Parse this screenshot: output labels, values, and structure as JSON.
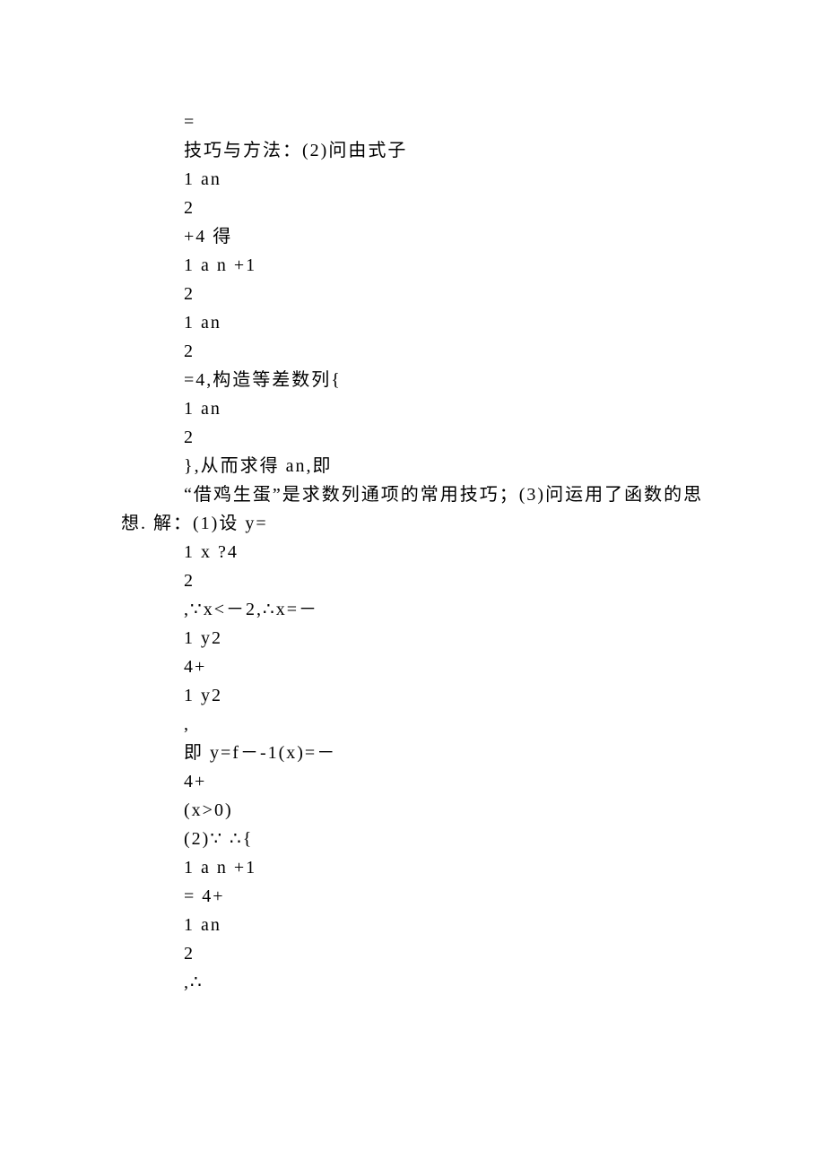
{
  "lines": [
    {
      "cls": "line",
      "text": "="
    },
    {
      "cls": "line",
      "text": "技巧与方法：(2)问由式子"
    },
    {
      "cls": "line",
      "text": "1 an"
    },
    {
      "cls": "line",
      "text": "2"
    },
    {
      "cls": "line",
      "text": "+4 得"
    },
    {
      "cls": "line",
      "text": "1 a n +1"
    },
    {
      "cls": "line",
      "text": "2"
    },
    {
      "cls": "line",
      "text": "1 an"
    },
    {
      "cls": "line",
      "text": "2"
    },
    {
      "cls": "line",
      "text": "=4,构造等差数列{"
    },
    {
      "cls": "line",
      "text": "1 an"
    },
    {
      "cls": "line",
      "text": "2"
    },
    {
      "cls": "line",
      "text": "},从而求得 an,即"
    },
    {
      "cls": "line",
      "text": "“借鸡生蛋”是求数列通项的常用技巧；(3)问运用了函数的思"
    },
    {
      "cls": "line-out",
      "text": "想. 解：(1)设 y="
    },
    {
      "cls": "line",
      "text": "1 x ?4"
    },
    {
      "cls": "line",
      "text": "2"
    },
    {
      "cls": "line",
      "text": ",∵x<－2,∴x=－"
    },
    {
      "cls": "line",
      "text": "1 y2"
    },
    {
      "cls": "line",
      "text": "4+"
    },
    {
      "cls": "line",
      "text": "1 y2"
    },
    {
      "cls": "line",
      "text": ","
    },
    {
      "cls": "line",
      "text": "即 y=f－-1(x)=－"
    },
    {
      "cls": "line",
      "text": "4+"
    },
    {
      "cls": "line",
      "text": "(x>0)"
    },
    {
      "cls": "line",
      "text": "(2)∵ ∴{"
    },
    {
      "cls": "line",
      "text": "1 a n +1"
    },
    {
      "cls": "line",
      "text": "= 4+"
    },
    {
      "cls": "line",
      "text": "1 an"
    },
    {
      "cls": "line",
      "text": "2"
    },
    {
      "cls": "line",
      "text": ",∴"
    }
  ]
}
